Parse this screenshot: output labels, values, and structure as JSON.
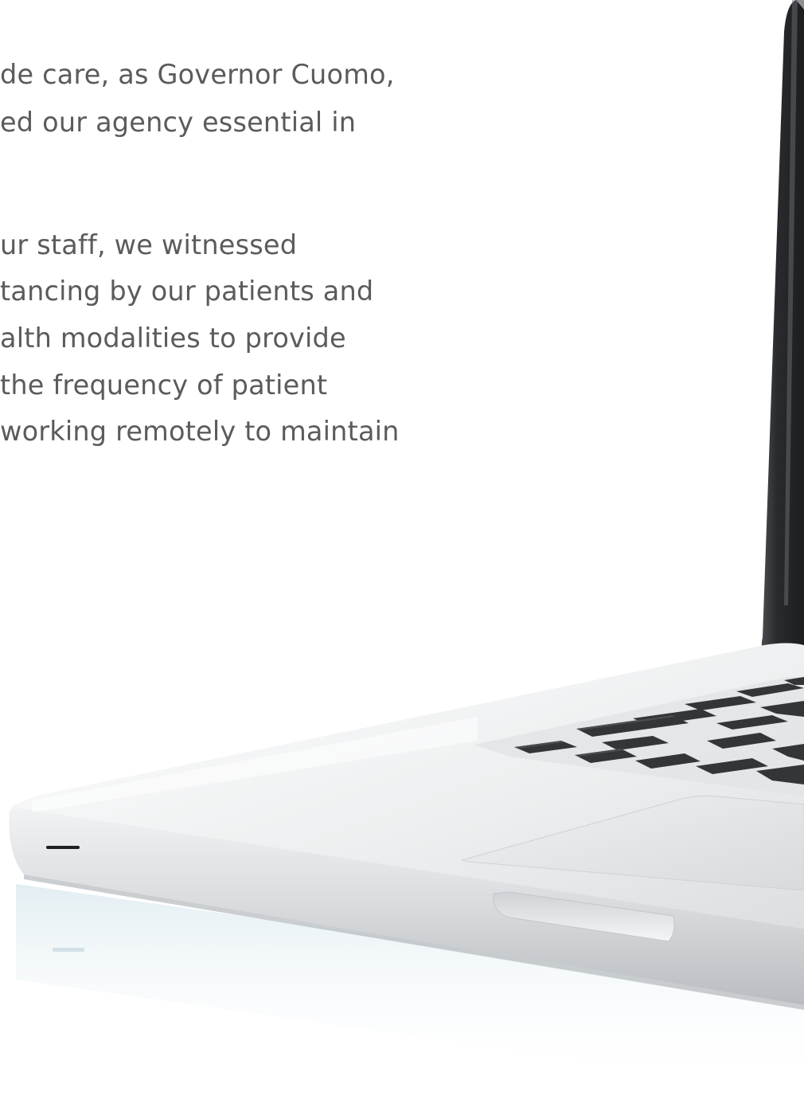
{
  "paragraphs": [
    {
      "lines": [
        "de care, as Governor Cuomo,",
        "ed our agency essential in"
      ]
    },
    {
      "lines": [
        "ur staff, we witnessed",
        "tancing by our patients and",
        "alth modalities to provide",
        " the frequency of patient",
        "working remotely to maintain"
      ]
    }
  ],
  "colors": {
    "body_text": "#5b5b5b",
    "background": "#ffffff",
    "laptop_body": "#e4e5e7",
    "laptop_screen_bezel": "#2c2d30",
    "key_dark": "#333538",
    "reflection": "#e7f1f5"
  },
  "illustration": {
    "name": "laptop-photo"
  }
}
